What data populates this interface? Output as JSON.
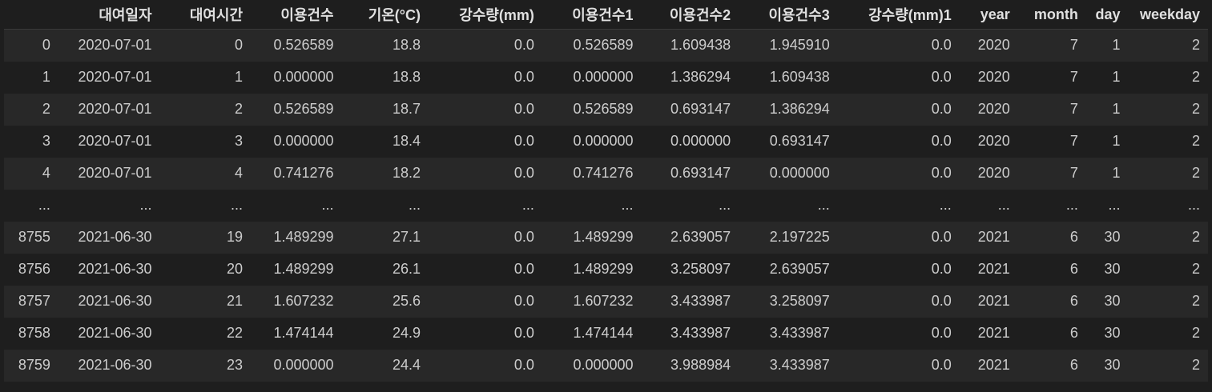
{
  "table": {
    "index_header": "",
    "columns": [
      "대여일자",
      "대여시간",
      "이용건수",
      "기온(°C)",
      "강수량(mm)",
      "이용건수1",
      "이용건수2",
      "이용건수3",
      "강수량(mm)1",
      "year",
      "month",
      "day",
      "weekday"
    ],
    "rows": [
      {
        "index": "0",
        "cells": [
          "2020-07-01",
          "0",
          "0.526589",
          "18.8",
          "0.0",
          "0.526589",
          "1.609438",
          "1.945910",
          "0.0",
          "2020",
          "7",
          "1",
          "2"
        ]
      },
      {
        "index": "1",
        "cells": [
          "2020-07-01",
          "1",
          "0.000000",
          "18.8",
          "0.0",
          "0.000000",
          "1.386294",
          "1.609438",
          "0.0",
          "2020",
          "7",
          "1",
          "2"
        ]
      },
      {
        "index": "2",
        "cells": [
          "2020-07-01",
          "2",
          "0.526589",
          "18.7",
          "0.0",
          "0.526589",
          "0.693147",
          "1.386294",
          "0.0",
          "2020",
          "7",
          "1",
          "2"
        ]
      },
      {
        "index": "3",
        "cells": [
          "2020-07-01",
          "3",
          "0.000000",
          "18.4",
          "0.0",
          "0.000000",
          "0.000000",
          "0.693147",
          "0.0",
          "2020",
          "7",
          "1",
          "2"
        ]
      },
      {
        "index": "4",
        "cells": [
          "2020-07-01",
          "4",
          "0.741276",
          "18.2",
          "0.0",
          "0.741276",
          "0.693147",
          "0.000000",
          "0.0",
          "2020",
          "7",
          "1",
          "2"
        ]
      },
      {
        "index": "...",
        "cells": [
          "...",
          "...",
          "...",
          "...",
          "...",
          "...",
          "...",
          "...",
          "...",
          "...",
          "...",
          "...",
          "..."
        ]
      },
      {
        "index": "8755",
        "cells": [
          "2021-06-30",
          "19",
          "1.489299",
          "27.1",
          "0.0",
          "1.489299",
          "2.639057",
          "2.197225",
          "0.0",
          "2021",
          "6",
          "30",
          "2"
        ]
      },
      {
        "index": "8756",
        "cells": [
          "2021-06-30",
          "20",
          "1.489299",
          "26.1",
          "0.0",
          "1.489299",
          "3.258097",
          "2.639057",
          "0.0",
          "2021",
          "6",
          "30",
          "2"
        ]
      },
      {
        "index": "8757",
        "cells": [
          "2021-06-30",
          "21",
          "1.607232",
          "25.6",
          "0.0",
          "1.607232",
          "3.433987",
          "3.258097",
          "0.0",
          "2021",
          "6",
          "30",
          "2"
        ]
      },
      {
        "index": "8758",
        "cells": [
          "2021-06-30",
          "22",
          "1.474144",
          "24.9",
          "0.0",
          "1.474144",
          "3.433987",
          "3.433987",
          "0.0",
          "2021",
          "6",
          "30",
          "2"
        ]
      },
      {
        "index": "8759",
        "cells": [
          "2021-06-30",
          "23",
          "0.000000",
          "24.4",
          "0.0",
          "0.000000",
          "3.988984",
          "3.433987",
          "0.0",
          "2021",
          "6",
          "30",
          "2"
        ]
      }
    ]
  }
}
